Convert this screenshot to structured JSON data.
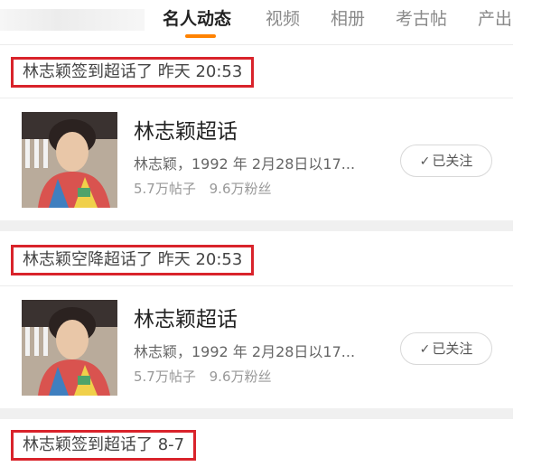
{
  "tabs": [
    {
      "label": "名人动态",
      "active": true
    },
    {
      "label": "视频",
      "active": false
    },
    {
      "label": "相册",
      "active": false
    },
    {
      "label": "考古帖",
      "active": false
    },
    {
      "label": "产出",
      "active": false
    }
  ],
  "colors": {
    "accent": "#ff8200",
    "highlight_border": "#d9232b"
  },
  "events": [
    {
      "header": "林志颖签到超话了 昨天 20:53",
      "card": {
        "title": "林志颖超话",
        "description": "林志颖，1992 年 2月28日以17...",
        "posts": "5.7万帖子",
        "fans": "9.6万粉丝",
        "follow_label": "已关注",
        "follow_icon": "check-icon"
      }
    },
    {
      "header": "林志颖空降超话了 昨天 20:53",
      "card": {
        "title": "林志颖超话",
        "description": "林志颖，1992 年 2月28日以17...",
        "posts": "5.7万帖子",
        "fans": "9.6万粉丝",
        "follow_label": "已关注",
        "follow_icon": "check-icon"
      }
    },
    {
      "header": "林志颖签到超话了 8-7"
    }
  ]
}
